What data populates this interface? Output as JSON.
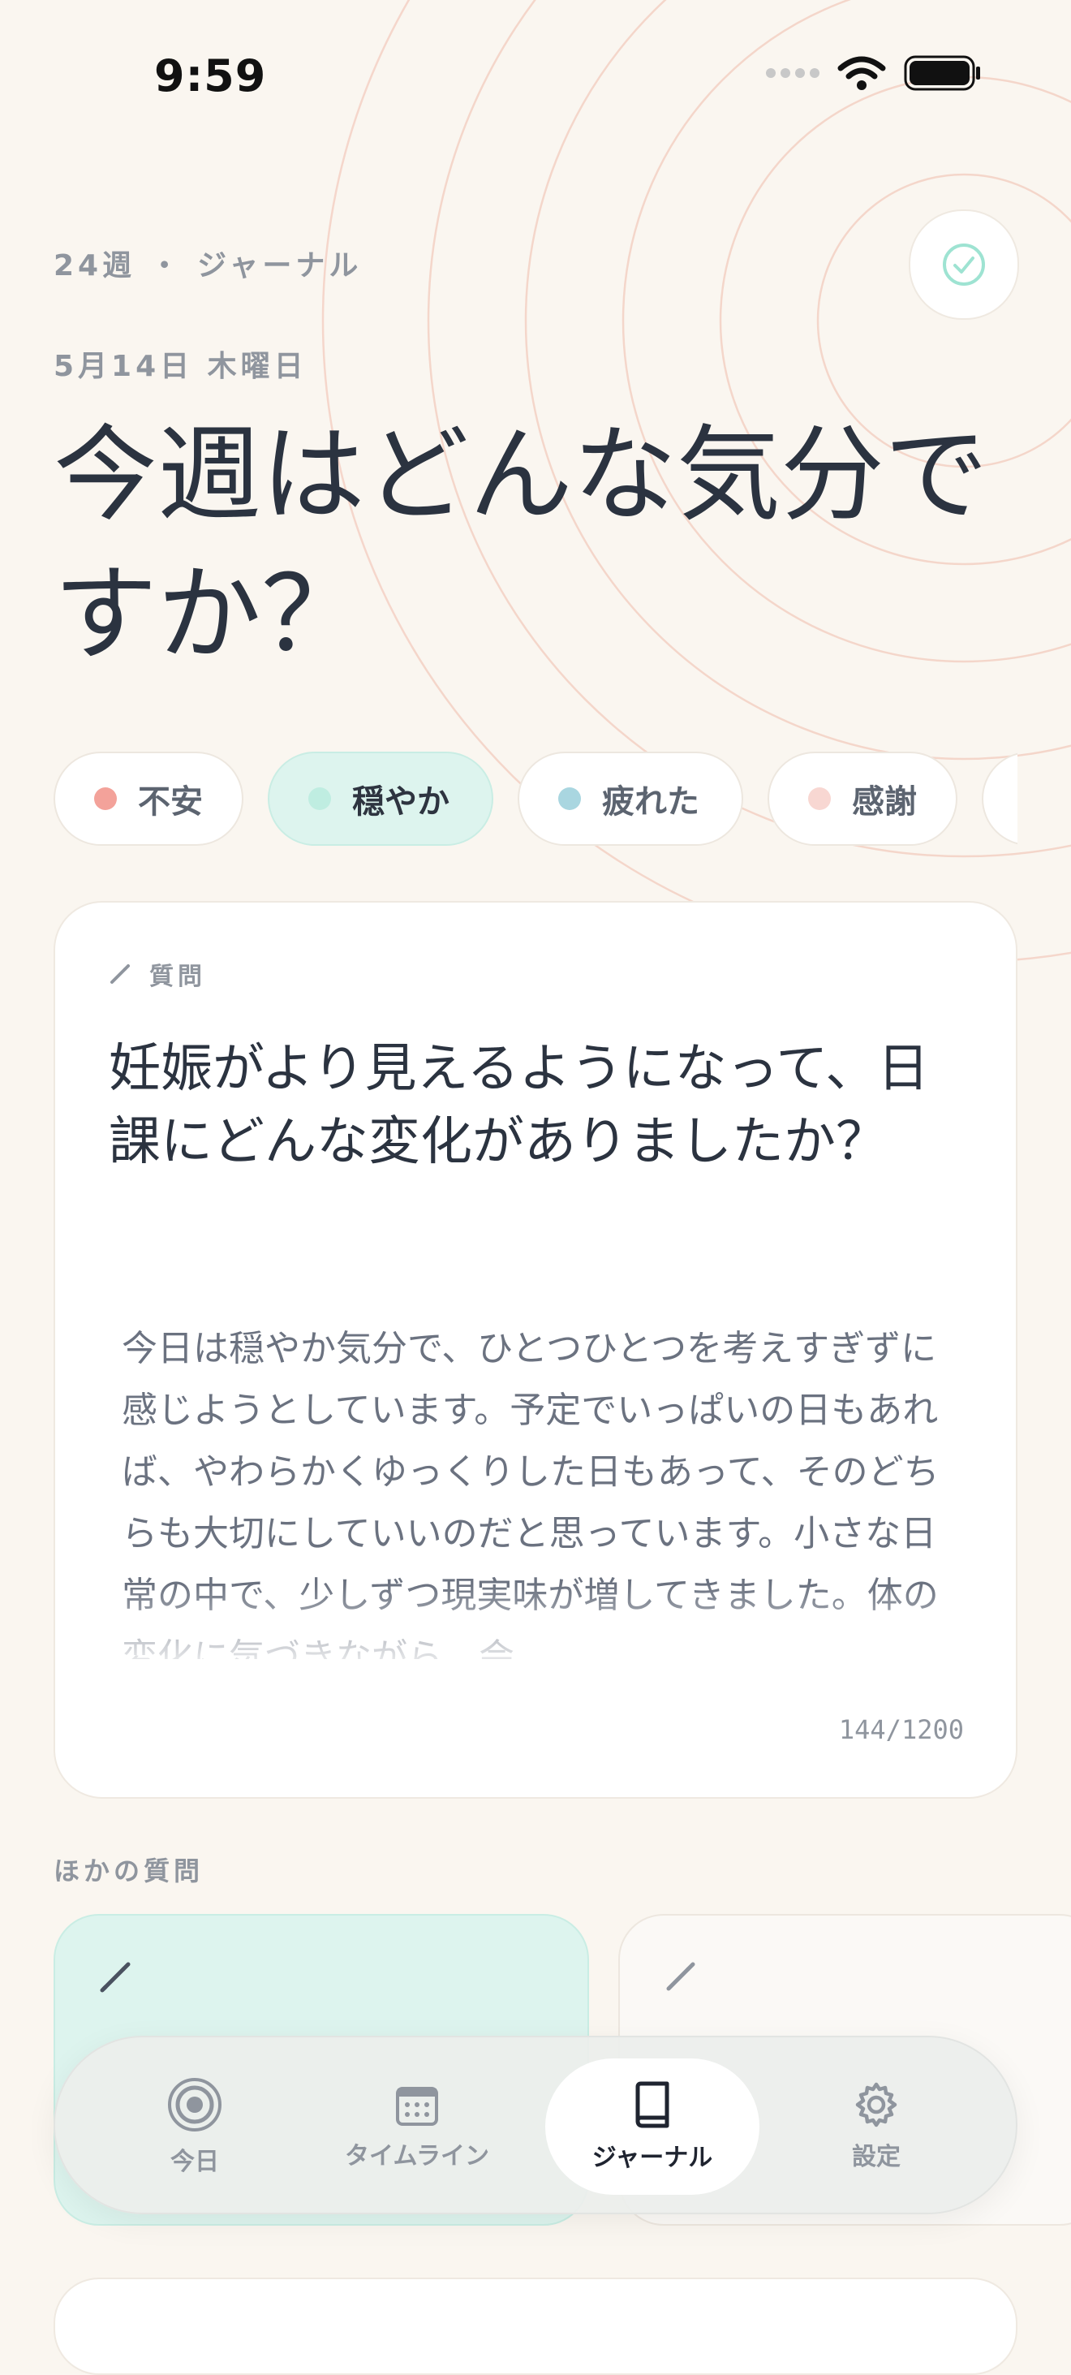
{
  "status_bar": {
    "time": "9:59"
  },
  "header": {
    "week_label": "24週 ・ ジャーナル",
    "date_label": "5月14日  木曜日",
    "title": "今週はどんな気分ですか？"
  },
  "moods": [
    {
      "label": "不安",
      "color": "#F3A29A"
    },
    {
      "label": "穏やか",
      "color": "#BFEDE1"
    },
    {
      "label": "疲れた",
      "color": "#A9D6E0"
    },
    {
      "label": "感謝",
      "color": "#F8D7D2"
    }
  ],
  "question_card": {
    "label": "質問",
    "question": "妊娠がより見えるようになって、日課にどんな変化がありましたか？",
    "answer": "今日は穏やか気分で、ひとつひとつを考えすぎずに感じようとしています。予定でいっぱいの日もあれば、やわらかくゆっくりした日もあって、そのどちらも大切にしていいのだと思っています。小さな日常の中で、少しずつ現実味が増してきました。体の変化に気づきながら、会",
    "counter": "144/1200"
  },
  "other_questions": {
    "label": "ほかの質問"
  },
  "tab_bar": {
    "tabs": [
      {
        "label": "今日",
        "icon": "rings-icon"
      },
      {
        "label": "タイムライン",
        "icon": "calendar-icon"
      },
      {
        "label": "ジャーナル",
        "icon": "book-icon",
        "active": true
      },
      {
        "label": "設定",
        "icon": "gear-icon"
      }
    ]
  },
  "colors": {
    "background": "#FAF6F0",
    "accent_mint": "#DDF4EE",
    "check": "#9EE3D2",
    "rings": "#F2C9BB"
  }
}
